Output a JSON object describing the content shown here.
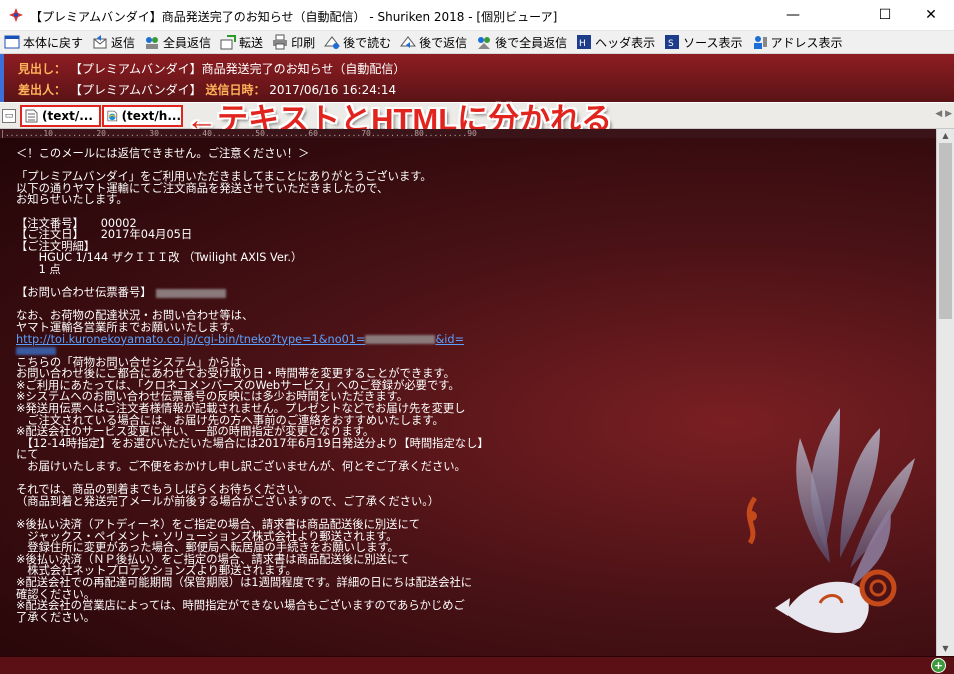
{
  "window": {
    "title": "【プレミアムバンダイ】商品発送完了のお知らせ（自動配信） - Shuriken 2018 - [個別ビューア]",
    "min_glyph": "—",
    "max_glyph": "☐",
    "close_glyph": "✕"
  },
  "toolbar": {
    "items": [
      {
        "label": "本体に戻す",
        "icon": "window-icon"
      },
      {
        "label": "返信",
        "icon": "reply-icon"
      },
      {
        "label": "全員返信",
        "icon": "reply-all-icon"
      },
      {
        "label": "転送",
        "icon": "forward-icon"
      },
      {
        "label": "印刷",
        "icon": "printer-icon"
      },
      {
        "label": "後で読む",
        "icon": "read-later-icon"
      },
      {
        "label": "後で返信",
        "icon": "reply-later-icon"
      },
      {
        "label": "後で全員返信",
        "icon": "reply-all-later-icon"
      },
      {
        "label": "ヘッダ表示",
        "icon": "header-icon"
      },
      {
        "label": "ソース表示",
        "icon": "source-icon"
      },
      {
        "label": "アドレス表示",
        "icon": "address-book-icon"
      }
    ]
  },
  "header": {
    "subject_label": "見出し：",
    "subject": "【プレミアムバンダイ】商品発送完了のお知らせ（自動配信）",
    "sender_label": "差出人：",
    "sender": "【プレミアムバンダイ】",
    "date_label": "送信日時：",
    "date": "2017/06/16 16:24:14"
  },
  "tabs": [
    {
      "label": "(text/..."
    },
    {
      "label": "(text/h..."
    }
  ],
  "annotation": "←テキストとHTMLに分かれる",
  "ruler": "|........10.........20.........30.........40.........50.........60.........70.........80.........90",
  "body": {
    "lines": [
      "＜！このメールには返信できません。ご注意ください！＞",
      "",
      "「プレミアムバンダイ」をご利用いただきましてまことにありがとうございます。",
      "以下の通りヤマト運輸にてご注文商品を発送させていただきましたので、",
      "お知らせいたします。",
      "",
      "【注文番号】　　00002",
      "【ご注文日】　　2017年04月05日",
      "【ご注文明細】",
      "　　HGUC 1/144 ザクＩＩＩ改 （Twilight AXIS Ver.）",
      "　　1 点",
      "",
      "【お問い合わせ伝票番号】",
      "",
      "なお、お荷物の配達状況・お問い合わせ等は、",
      "ヤマト運輸各営業所までお願いいたします。",
      "http://toi.kuronekoyamato.co.jp/cgi-bin/tneko?type=1&no01=",
      "",
      "こちらの「荷物お問い合せシステム」からは、",
      "お問い合わせ後にご都合にあわせてお受け取り日・時間帯を変更することができます。",
      "※ご利用にあたっては、「クロネコメンバーズのWebサービス」へのご登録が必要です。",
      "※システムへのお問い合わせ伝票番号の反映には多少お時間をいただきます。",
      "※発送用伝票へはご注文者様情報が記載されません。プレゼントなどでお届け先を変更し",
      "　ご注文されている場合には、お届け先の方へ事前のご連絡をおすすめいたします。",
      "※配送会社のサービス変更に伴い、一部の時間指定が変更となります。",
      "　【12-14時指定】をお選びいただいた場合には2017年6月19日発送分より【時間指定なし】",
      "にて",
      "　お届けいたします。ご不便をおかけし申し訳ございませんが、何とぞご了承ください。",
      "",
      "それでは、商品の到着までもうしばらくお待ちください。",
      "（商品到着と発送完了メールが前後する場合がございますので、ご了承ください。）",
      "",
      "※後払い決済（アトディーネ）をご指定の場合、請求書は商品配送後に別送にて",
      "　ジャックス・ペイメント・ソリューションズ株式会社より郵送されます。",
      "　登録住所に変更があった場合、郵便局へ転居届の手続きをお願いします。",
      "※後払い決済（ＮＰ後払い）をご指定の場合、請求書は商品配送後に別送にて",
      "　株式会社ネットプロテクションズより郵送されます。",
      "※配送会社での再配達可能期間（保管期限）は1週間程度です。詳細の日にちは配送会社に",
      "確認ください。",
      "※配送会社の営業店によっては、時間指定ができない場合もございますのであらかじめご",
      "了承ください。"
    ],
    "link_tail": "&id="
  },
  "colors": {
    "accent_red": "#e2241e",
    "header_label": "#ffb25a",
    "link": "#5aa0ff"
  }
}
